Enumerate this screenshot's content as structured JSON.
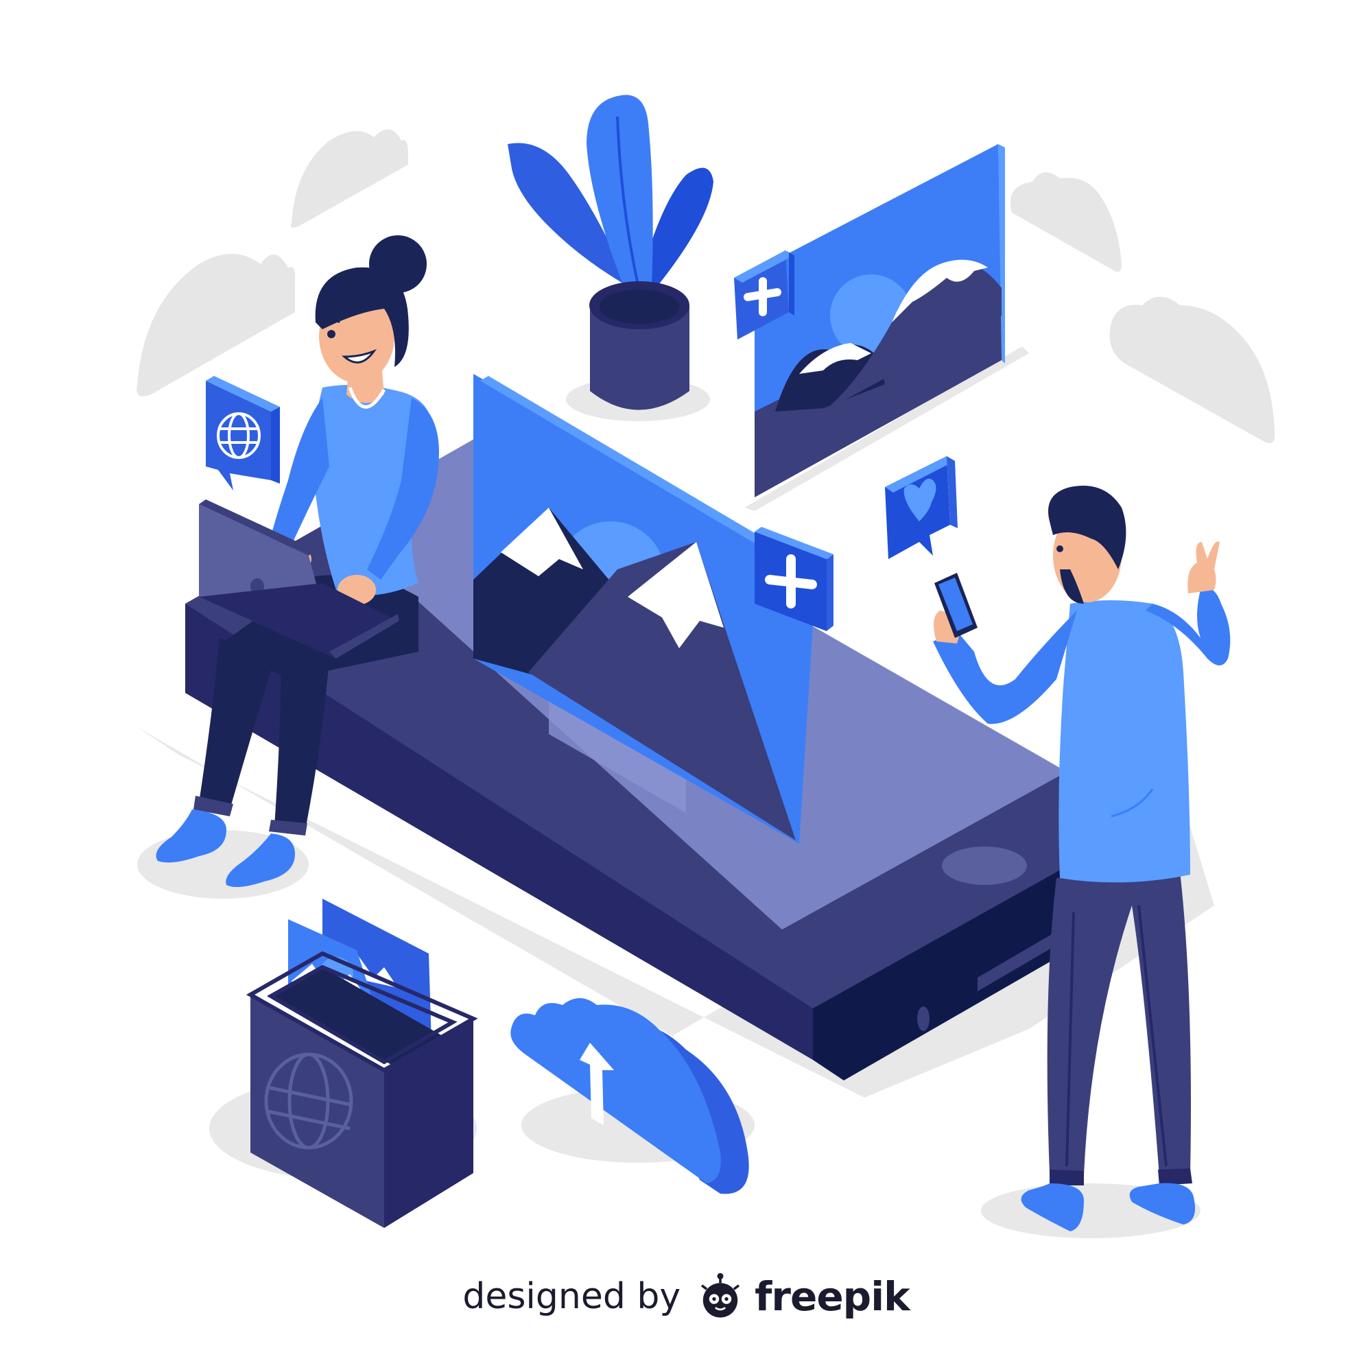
{
  "illustration": {
    "credit_prefix": "designed by",
    "credit_brand": "freepik"
  },
  "icons": [
    "globe-icon",
    "plus-icon",
    "heart-icon",
    "upload-arrow-icon",
    "mountain-image-icon",
    "cloud-icon",
    "laptop-icon",
    "smartphone-icon",
    "plant-pot-icon",
    "freepik-logo-icon"
  ],
  "colors": {
    "primary_blue": "#3d7ef7",
    "light_blue": "#5a9cff",
    "royal_blue": "#2f5fe0",
    "deep_blue": "#1f4ed8",
    "indigo": "#3b3f7c",
    "navy": "#262868",
    "dark_navy": "#1a2456",
    "slate": "#5a5f9e",
    "cloud_gray": "#e6e6e6",
    "skin": "#f6b894",
    "white": "#ffffff"
  }
}
